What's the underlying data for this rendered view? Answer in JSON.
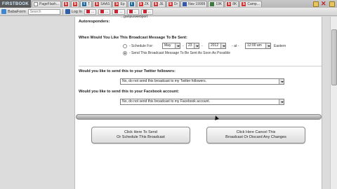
{
  "browser": {
    "logo_text": "FIRSTBOOK",
    "tabs": [
      {
        "icon": "page-icon",
        "label": "PageFlash..."
      },
      {
        "icon": "b-icon",
        "label": "..."
      },
      {
        "icon": "b-icon",
        "label": "..."
      },
      {
        "icon": "t-icon",
        "label": "T"
      },
      {
        "icon": "b-icon",
        "label": "SAAS"
      },
      {
        "icon": "b-icon",
        "label": "Ep"
      },
      {
        "icon": "t-icon",
        "label": "..."
      },
      {
        "icon": "b-icon",
        "label": "ZK"
      },
      {
        "icon": "b-icon",
        "label": "JE"
      },
      {
        "icon": "b-icon",
        "label": "Dr"
      },
      {
        "icon": "b-icon",
        "label": "Dir"
      },
      {
        "icon": "mail-icon",
        "label": "Nav 19999"
      },
      {
        "icon": "chat-icon",
        "label": "19K"
      },
      {
        "icon": "b-icon",
        "label": "8K"
      },
      {
        "icon": "b-icon",
        "label": "..."
      },
      {
        "icon": "b-icon",
        "label": "Camp..."
      }
    ]
  },
  "toolbar": {
    "item1": "BabaForm",
    "search_placeholder": "Search",
    "login": "Log In",
    "badges": [
      "...",
      "...",
      "...",
      "...",
      "..."
    ]
  },
  "form": {
    "top_text": "...ganpuswebport",
    "autoresponders_label": "Autoresponders:",
    "when_question": "When Would You Like This Broadcast Message To Be Sent:",
    "schedule_label": "- Schedule For:",
    "month": "May",
    "day": "23",
    "year": "2012",
    "at_label": "at",
    "time": "12:00 am",
    "timezone": "Eastern",
    "send_asap_label": "- Send This Broadcast Message To Be Sent As Soon As Possible",
    "twitter_question": "Would you like to send this to your Twitter followers:",
    "twitter_value": "No, do not send this broadcast to my Twitter followers.",
    "facebook_question": "Would you like to send this to your Facebook account:",
    "facebook_value": "No, do not send this broadcast to my Facebook account.",
    "send_button_line1": "Click Here To Send",
    "send_button_line2": "Or Schedule This Broadcast",
    "cancel_button_line1": "Click Here Cancel This",
    "cancel_button_line2": "Broadcast Or Discard Any Changes"
  }
}
